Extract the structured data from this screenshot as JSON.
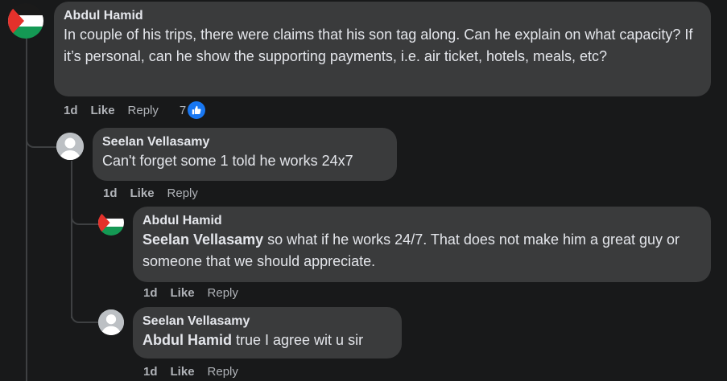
{
  "comments": [
    {
      "author": "Abdul Hamid",
      "text": "In couple of his trips, there were claims that his son tag along. Can he explain on what capacity? If it’s personal, can he show the supporting payments, i.e. air ticket, hotels, meals, etc?",
      "time": "1d",
      "like_label": "Like",
      "reply_label": "Reply",
      "reaction_count": "7"
    },
    {
      "author": "Seelan Vellasamy",
      "text": "Can't forget some 1 told he works 24x7",
      "time": "1d",
      "like_label": "Like",
      "reply_label": "Reply"
    },
    {
      "author": "Abdul Hamid",
      "mention": "Seelan Vellasamy",
      "text": " so what if he works 24/7. That does not make him a great guy or someone that we should appreciate.",
      "time": "1d",
      "like_label": "Like",
      "reply_label": "Reply"
    },
    {
      "author": "Seelan Vellasamy",
      "mention": "Abdul Hamid",
      "text": " true I agree wit u sir",
      "time": "1d",
      "like_label": "Like",
      "reply_label": "Reply"
    }
  ],
  "icons": {
    "flag": "palestine-flag-avatar",
    "default_avatar": "default-user-avatar",
    "like": "thumbs-up-icon"
  },
  "colors": {
    "background": "#18191a",
    "bubble": "#3a3b3c",
    "text": "#e4e6eb",
    "muted": "#b0b3b8",
    "like_blue": "#1877f2"
  }
}
